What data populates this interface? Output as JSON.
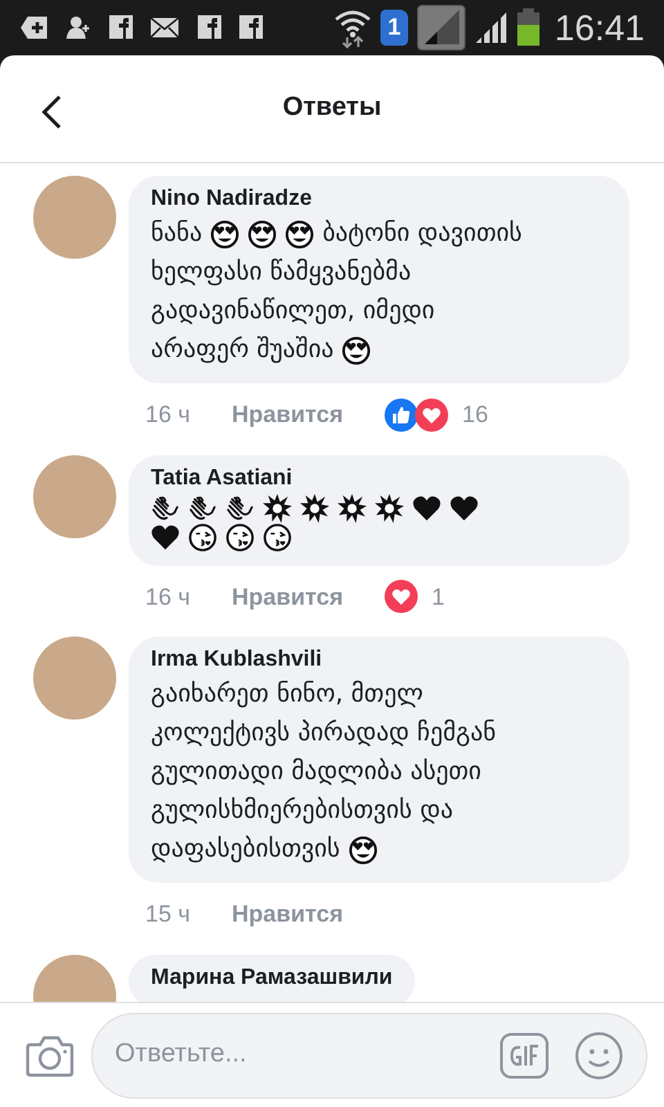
{
  "status_bar": {
    "sim_badge": "1",
    "time": "16:41"
  },
  "header": {
    "title": "Ответы"
  },
  "comments": [
    {
      "author": "Nino Nadiradze",
      "body": [
        [
          {
            "kind": "text",
            "text": "ნანა"
          },
          {
            "kind": "heart_eyes"
          },
          {
            "kind": "heart_eyes"
          },
          {
            "kind": "heart_eyes"
          },
          {
            "kind": "text",
            "text": "ბატონი დავითის"
          }
        ],
        [
          {
            "kind": "text",
            "text": "ხელფასი წამყვანებმა"
          }
        ],
        [
          {
            "kind": "text",
            "text": "გადავინაწილეთ, იმედი"
          }
        ],
        [
          {
            "kind": "text",
            "text": "არაფერ შუაშია"
          },
          {
            "kind": "heart_eyes"
          }
        ]
      ],
      "time": "16 ч",
      "like_label": "Нравится",
      "reactions": [
        {
          "kind": "like"
        },
        {
          "kind": "love"
        }
      ],
      "reaction_count": "16"
    },
    {
      "author": "Tatia Asatiani",
      "body": [
        [
          {
            "kind": "clap"
          },
          {
            "kind": "clap"
          },
          {
            "kind": "clap"
          },
          {
            "kind": "collision"
          },
          {
            "kind": "collision"
          },
          {
            "kind": "collision"
          },
          {
            "kind": "collision"
          },
          {
            "kind": "heart"
          },
          {
            "kind": "heart"
          }
        ],
        [
          {
            "kind": "heart"
          },
          {
            "kind": "kiss"
          },
          {
            "kind": "kiss"
          },
          {
            "kind": "kiss"
          }
        ]
      ],
      "time": "16 ч",
      "like_label": "Нравится",
      "reactions": [
        {
          "kind": "love"
        }
      ],
      "reaction_count": "1"
    },
    {
      "author": "Irma Kublashvili",
      "body": [
        [
          {
            "kind": "text",
            "text": "გაიხარეთ ნინო, მთელ"
          }
        ],
        [
          {
            "kind": "text",
            "text": "კოლექტივს პირადად ჩემგან"
          }
        ],
        [
          {
            "kind": "text",
            "text": "გულითადი მადლიბა ასეთი"
          }
        ],
        [
          {
            "kind": "text",
            "text": "გულისხმიერებისთვის და"
          }
        ],
        [
          {
            "kind": "text",
            "text": "დაფასებისთვის"
          },
          {
            "kind": "heart_eyes"
          }
        ]
      ],
      "time": "15 ч",
      "like_label": "Нравится"
    },
    {
      "author": "Марина Рамазашвили"
    }
  ],
  "composer": {
    "placeholder": "Ответьте..."
  }
}
